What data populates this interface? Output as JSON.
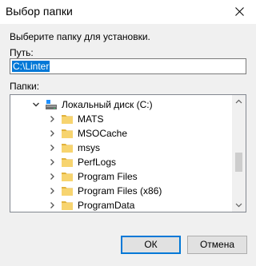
{
  "window": {
    "title": "Выбор папки"
  },
  "instruction": "Выберите папку для установки.",
  "path": {
    "label": "Путь:",
    "value": "C:\\Linter"
  },
  "folders": {
    "label": "Папки:",
    "root": "Локальный диск (C:)",
    "items": [
      "MATS",
      "MSOCache",
      "msys",
      "PerfLogs",
      "Program Files",
      "Program Files (x86)",
      "ProgramData"
    ]
  },
  "buttons": {
    "ok": "ОК",
    "cancel": "Отмена"
  },
  "colors": {
    "selection": "#0078d7",
    "folder": "#f7d46f",
    "folder_dark": "#e1b23c"
  },
  "icons": {
    "close": "close-icon",
    "drive": "drive-icon",
    "folder": "folder-icon",
    "expand": "chevron-right-icon",
    "collapse": "chevron-down-icon"
  }
}
